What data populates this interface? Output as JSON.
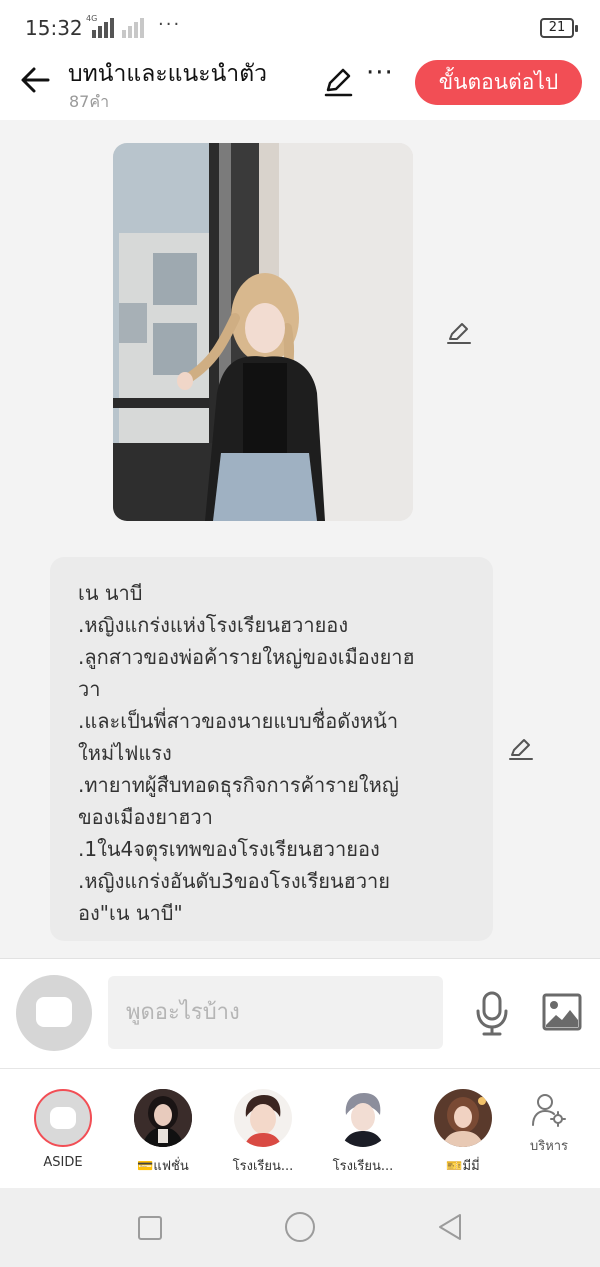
{
  "status_bar": {
    "time": "15:32",
    "network": "4G",
    "battery": "21"
  },
  "header": {
    "title": "บทนำและแนะนำตัว",
    "subtitle": "87คำ",
    "next_button": "ขั้นตอนต่อไป",
    "more_label": "···"
  },
  "story": {
    "text_lines": [
      "เน นาบี",
      ".หญิงแกร่งแห่งโรงเรียนฮวายอง",
      ".ลูกสาวของพ่อค้ารายใหญ่ของเมืองยาฮ",
      "วา",
      ".และเป็นพี่สาวของนายแบบชื่อดังหน้า",
      "ใหม่ไฟแรง",
      ".ทายาทผู้สืบทอดธุรกิจการค้ารายใหญ่",
      "ของเมืองยาฮวา",
      ".1ใน4จตุรเทพของโรงเรียนฮวายอง",
      ".หญิงแกร่งอันดับ3ของโรงเรียนฮวาย",
      "อง\"เน นาบี\""
    ]
  },
  "composer": {
    "placeholder": "พูดอะไรบ้าง"
  },
  "characters": [
    {
      "label": "ASIDE"
    },
    {
      "label": "💳แฟชั่น"
    },
    {
      "label": "โรงเรียน..."
    },
    {
      "label": "โรงเรียน..."
    },
    {
      "label": "🎫มีมี่"
    }
  ],
  "manage_label": "บริหาร",
  "colors": {
    "accent": "#f24e55",
    "background": "#f3f3f3",
    "bubble": "#ebebeb"
  }
}
